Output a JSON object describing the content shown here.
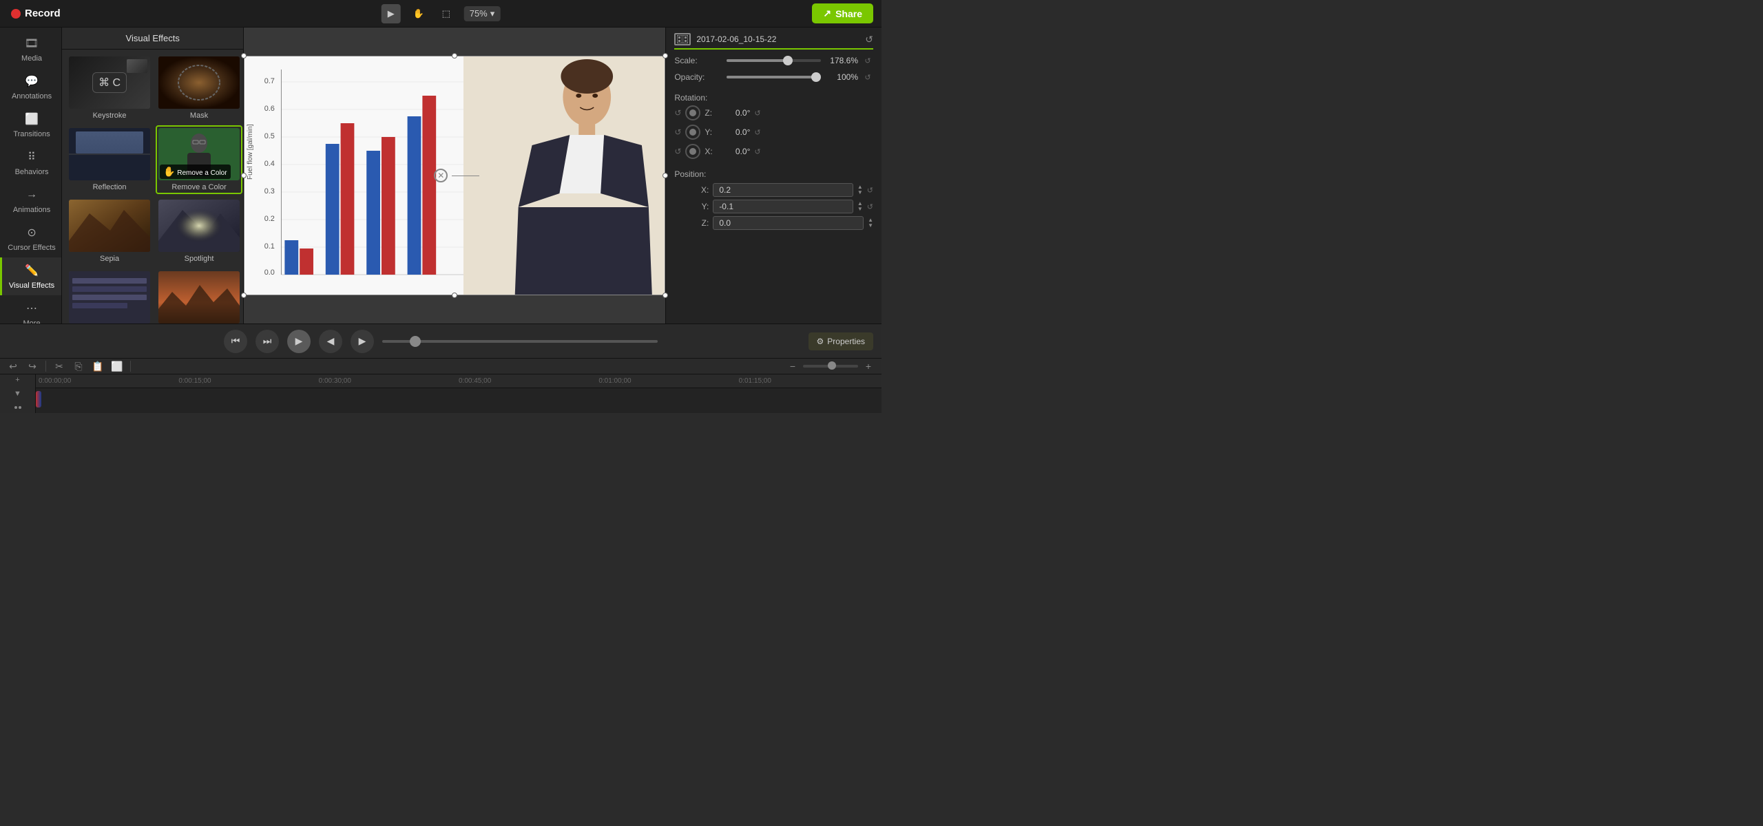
{
  "topbar": {
    "record_label": "Record",
    "share_label": "Share",
    "zoom_level": "75%",
    "tools": [
      "pointer",
      "hand",
      "crop"
    ]
  },
  "sidebar": {
    "items": [
      {
        "id": "media",
        "label": "Media",
        "icon": "🎞"
      },
      {
        "id": "annotations",
        "label": "Annotations",
        "icon": "💬"
      },
      {
        "id": "transitions",
        "label": "Transitions",
        "icon": "⬜"
      },
      {
        "id": "behaviors",
        "label": "Behaviors",
        "icon": "⠿"
      },
      {
        "id": "animations",
        "label": "Animations",
        "icon": "→"
      },
      {
        "id": "cursor-effects",
        "label": "Cursor Effects",
        "icon": "⊙"
      },
      {
        "id": "visual-effects",
        "label": "Visual Effects",
        "icon": "✏️"
      },
      {
        "id": "more",
        "label": "More",
        "icon": "⋮"
      }
    ]
  },
  "effects_panel": {
    "title": "Visual Effects",
    "effects": [
      {
        "id": "keystroke",
        "label": "Keystroke"
      },
      {
        "id": "mask",
        "label": "Mask"
      },
      {
        "id": "reflection",
        "label": "Reflection"
      },
      {
        "id": "remove-color",
        "label": "Remove a Color",
        "selected": true
      },
      {
        "id": "sepia",
        "label": "Sepia"
      },
      {
        "id": "spotlight",
        "label": "Spotlight"
      },
      {
        "id": "item7",
        "label": ""
      },
      {
        "id": "item8",
        "label": ""
      }
    ]
  },
  "canvas": {
    "zoom": "75%"
  },
  "properties": {
    "title": "2017-02-06_10-15-22",
    "scale_label": "Scale:",
    "scale_value": "178.6%",
    "opacity_label": "Opacity:",
    "opacity_value": "100%",
    "rotation_label": "Rotation:",
    "rotation_z": "0.0°",
    "rotation_y": "0.0°",
    "rotation_x": "0.0°",
    "position_label": "Position:",
    "position_x": "0.2",
    "position_y": "-0.1",
    "position_z": "0.0"
  },
  "playback": {
    "properties_btn": "Properties"
  },
  "timeline": {
    "time_start": "0:00:00;00",
    "marks": [
      "0:00:00;00",
      "0:00:15;00",
      "0:00:30;00",
      "0:00:45;00",
      "0:01:00;00",
      "0:01:15;00"
    ]
  }
}
